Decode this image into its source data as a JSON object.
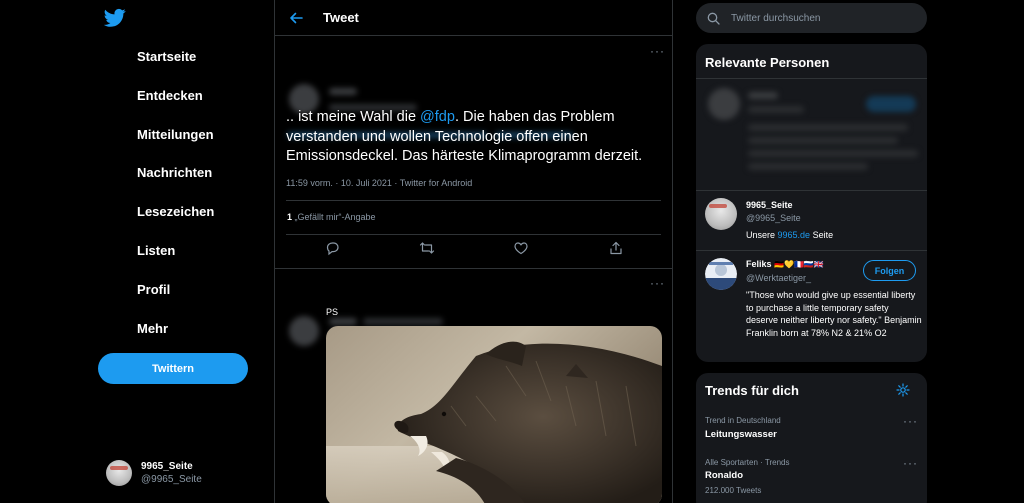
{
  "nav": {
    "items": [
      "Startseite",
      "Entdecken",
      "Mitteilungen",
      "Nachrichten",
      "Lesezeichen",
      "Listen",
      "Profil",
      "Mehr"
    ],
    "tweet_button": "Twittern",
    "account": {
      "name": "9965_Seite",
      "handle": "@9965_Seite"
    }
  },
  "header": {
    "title": "Tweet"
  },
  "tweet": {
    "text_before": ".. ist meine Wahl die ",
    "mention": "@fdp",
    "text_after": ". Die haben das Problem verstanden und wollen Technologie offen einen Emissionsdeckel. Das härteste Klimaprogramm derzeit.",
    "meta": "11:59 vorm. · 10. Juli 2021 · Twitter for Android",
    "likes_count": "1",
    "likes_label": "„Gefällt mir“-Angabe"
  },
  "reply": {
    "text": "PS"
  },
  "search": {
    "placeholder": "Twitter durchsuchen"
  },
  "relevant": {
    "title": "Relevante Personen",
    "people": [
      {
        "name": "9965_Seite",
        "handle": "@9965_Seite",
        "bio_before": "Unsere ",
        "bio_link": "9965.de",
        "bio_after": " Seite"
      },
      {
        "name": "Feliks",
        "flags": "🇩🇪💛🇫🇷🇷🇺🇬🇧",
        "handle": "@Werktaetiger_",
        "bio": "\"Those who would give up essential liberty to purchase a little temporary safety deserve neither liberty nor safety.\" Benjamin Franklin born at 78% N2 & 21% O2",
        "follow_label": "Folgen"
      }
    ]
  },
  "trends": {
    "title": "Trends für dich",
    "items": [
      {
        "context": "Trend in Deutschland",
        "name": "Leitungswasser"
      },
      {
        "context": "Alle Sportarten · Trends",
        "name": "Ronaldo",
        "count": "212.000 Tweets"
      }
    ]
  },
  "colors": {
    "accent": "#1d9bf0",
    "background": "#000000",
    "panel": "#16181c",
    "border": "#2f3336"
  }
}
